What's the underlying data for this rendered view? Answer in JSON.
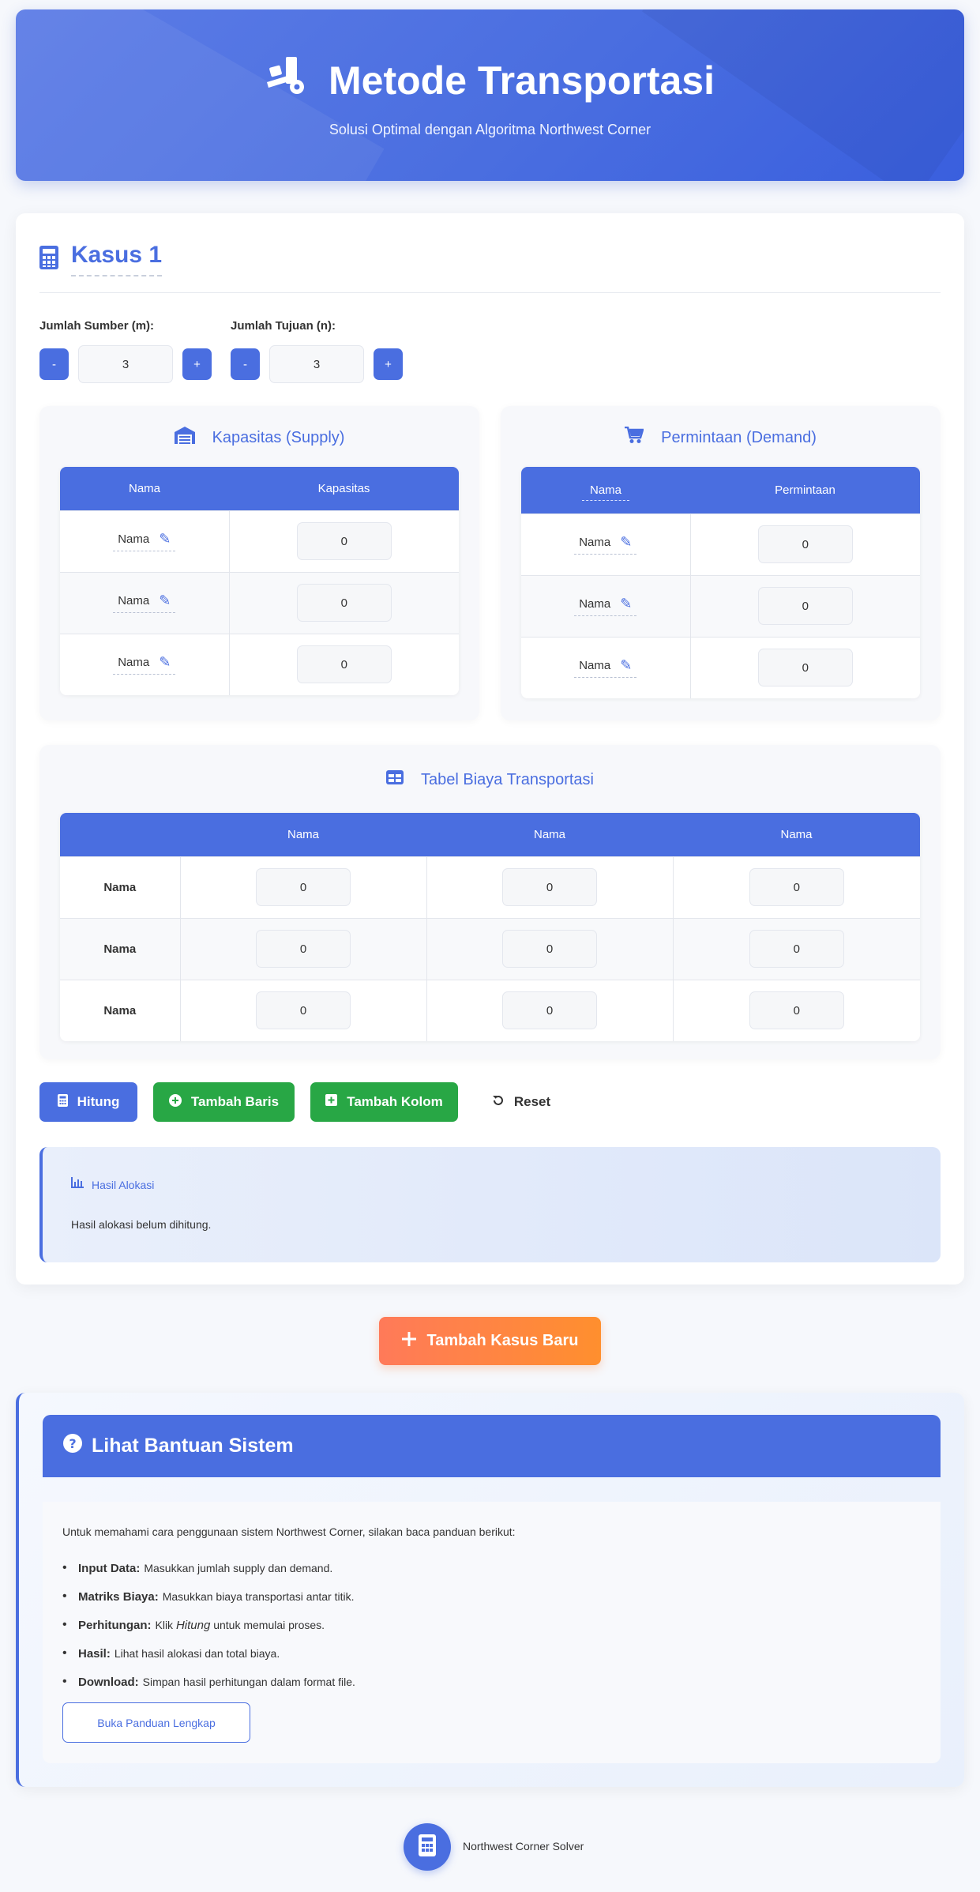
{
  "header": {
    "title": "Metode Transportasi",
    "subtitle": "Solusi Optimal dengan Algoritma Northwest Corner"
  },
  "case": {
    "title": "Kasus 1",
    "sources_label": "Jumlah Sumber (m):",
    "sources_value": "3",
    "dest_label": "Jumlah Tujuan (n):",
    "dest_value": "3",
    "minus": "-",
    "plus": "+"
  },
  "supply": {
    "title": "Kapasitas (Supply)",
    "col_name": "Nama",
    "col_value": "Kapasitas",
    "rows": [
      {
        "name": "Nama",
        "value": "0"
      },
      {
        "name": "Nama",
        "value": "0"
      },
      {
        "name": "Nama",
        "value": "0"
      }
    ]
  },
  "demand": {
    "title": "Permintaan (Demand)",
    "col_name": "Nama",
    "col_value": "Permintaan",
    "rows": [
      {
        "name": "Nama",
        "value": "0"
      },
      {
        "name": "Nama",
        "value": "0"
      },
      {
        "name": "Nama",
        "value": "0"
      }
    ]
  },
  "cost": {
    "title": "Tabel Biaya Transportasi",
    "columns": [
      "Nama",
      "Nama",
      "Nama"
    ],
    "rows": [
      {
        "name": "Nama",
        "values": [
          "0",
          "0",
          "0"
        ]
      },
      {
        "name": "Nama",
        "values": [
          "0",
          "0",
          "0"
        ]
      },
      {
        "name": "Nama",
        "values": [
          "0",
          "0",
          "0"
        ]
      }
    ]
  },
  "actions": {
    "hitung": "Hitung",
    "tambah_baris": "Tambah Baris",
    "tambah_kolom": "Tambah Kolom",
    "reset": "Reset"
  },
  "result": {
    "title": "Hasil Alokasi",
    "text": "Hasil alokasi belum dihitung."
  },
  "add_case": "Tambah Kasus Baru",
  "help": {
    "title": "Lihat Bantuan Sistem",
    "intro": "Untuk memahami cara penggunaan sistem Northwest Corner, silakan baca panduan berikut:",
    "items": [
      {
        "bold": "Input Data:",
        "text": "Masukkan jumlah supply dan demand."
      },
      {
        "bold": "Matriks Biaya:",
        "text": "Masukkan biaya transportasi antar titik."
      },
      {
        "bold": "Perhitungan:",
        "text_before": "Klik",
        "italic": "Hitung",
        "text": "untuk memulai proses."
      },
      {
        "bold": "Hasil:",
        "text": "Lihat hasil alokasi dan total biaya."
      },
      {
        "bold": "Download:",
        "text": "Simpan hasil perhitungan dalam format file."
      }
    ],
    "guide_button": "Buka Panduan Lengkap"
  },
  "footer": {
    "text": "Northwest Corner Solver"
  },
  "colors": {
    "primary": "#4a6ee0",
    "success": "#28a745",
    "orange": "#ff8a3d"
  }
}
